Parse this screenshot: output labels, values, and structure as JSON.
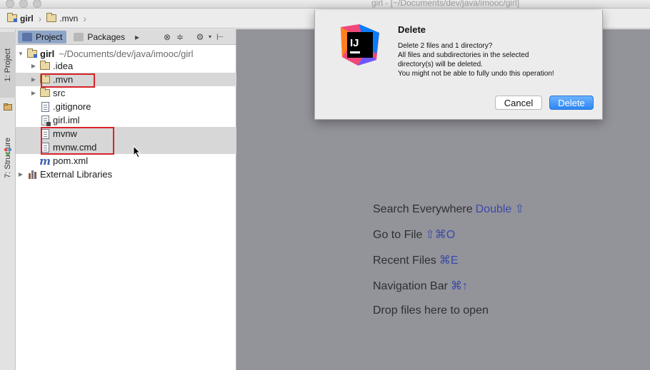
{
  "window": {
    "title": "girl - [~/Documents/dev/java/imooc/girl]"
  },
  "breadcrumbs": [
    {
      "label": "girl"
    },
    {
      "label": ".mvn"
    }
  ],
  "tool_stripe": {
    "project_tab": "1: Project",
    "structure_tab": "7: Structure"
  },
  "project_panel": {
    "tabs": [
      {
        "label": "Project",
        "selected": true
      },
      {
        "label": "Packages",
        "selected": false
      }
    ],
    "root": {
      "name": "girl",
      "path": "~/Documents/dev/java/imooc/girl"
    },
    "items": [
      {
        "label": ".idea",
        "type": "folder",
        "expandable": true
      },
      {
        "label": ".mvn",
        "type": "folder",
        "expandable": true,
        "selected": true,
        "boxed": true
      },
      {
        "label": "src",
        "type": "folder",
        "expandable": true
      },
      {
        "label": ".gitignore",
        "type": "file"
      },
      {
        "label": "girl.iml",
        "type": "iml-file"
      },
      {
        "label": "mvnw",
        "type": "file",
        "selected": true,
        "boxed": true
      },
      {
        "label": "mvnw.cmd",
        "type": "file",
        "selected": true,
        "boxed": true
      },
      {
        "label": "pom.xml",
        "type": "maven-file"
      }
    ],
    "external_libraries": "External Libraries"
  },
  "editor_tips": [
    {
      "text": "Search Everywhere",
      "shortcut": "Double ⇧"
    },
    {
      "text": "Go to File",
      "shortcut": "⇧⌘O"
    },
    {
      "text": "Recent Files",
      "shortcut": "⌘E"
    },
    {
      "text": "Navigation Bar",
      "shortcut": "⌘↑"
    },
    {
      "text": "Drop files here to open",
      "shortcut": ""
    }
  ],
  "dialog": {
    "title": "Delete",
    "lines": [
      "Delete 2 files and 1 directory?",
      "All files and subdirectories in the selected",
      "directory(s) will be deleted.",
      "You might not be able to fully undo this operation!"
    ],
    "icon_text": "IJ",
    "cancel_label": "Cancel",
    "delete_label": "Delete"
  },
  "colors": {
    "selection_blue": "#8fa5c8",
    "highlight_red": "#d8232a",
    "primary_button": "#2c86f2",
    "editor_bg": "#93939a"
  }
}
